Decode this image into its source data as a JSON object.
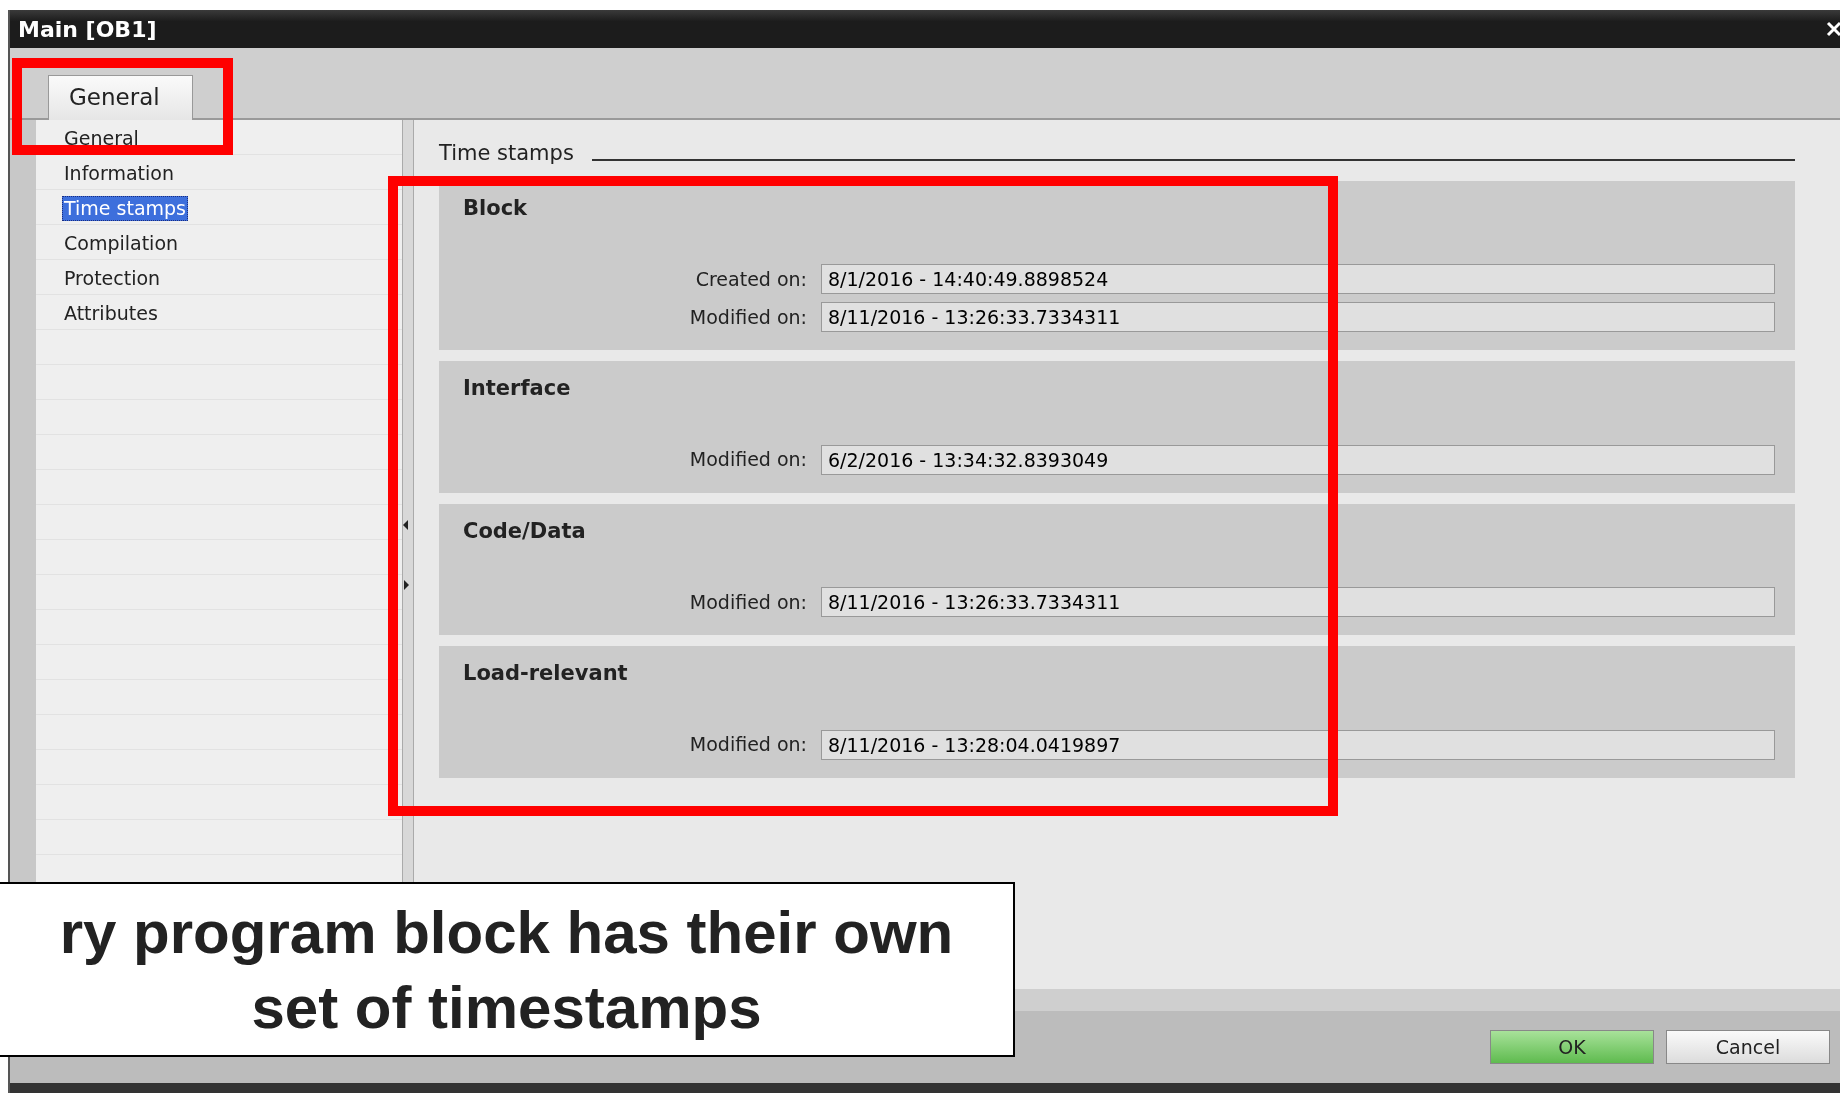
{
  "window": {
    "title": "Main [OB1]"
  },
  "tabs": [
    {
      "label": "General",
      "selected": true
    }
  ],
  "sidebar": {
    "items": [
      {
        "label": "General",
        "selected": false
      },
      {
        "label": "Information",
        "selected": false
      },
      {
        "label": "Time stamps",
        "selected": true
      },
      {
        "label": "Compilation",
        "selected": false
      },
      {
        "label": "Protection",
        "selected": false
      },
      {
        "label": "Attributes",
        "selected": false
      }
    ]
  },
  "section": {
    "title": "Time stamps",
    "groups": [
      {
        "title": "Block",
        "fields": [
          {
            "label": "Created on:",
            "value": "8/1/2016 - 14:40:49.8898524"
          },
          {
            "label": "Modified on:",
            "value": "8/11/2016 - 13:26:33.7334311"
          }
        ]
      },
      {
        "title": "Interface",
        "fields": [
          {
            "label": "Modified on:",
            "value": "6/2/2016 - 13:34:32.8393049"
          }
        ]
      },
      {
        "title": "Code/Data",
        "fields": [
          {
            "label": "Modified on:",
            "value": "8/11/2016 - 13:26:33.7334311"
          }
        ]
      },
      {
        "title": "Load-relevant",
        "fields": [
          {
            "label": "Modified on:",
            "value": "8/11/2016 - 13:28:04.0419897"
          }
        ]
      }
    ]
  },
  "buttons": [
    {
      "label": "OK",
      "kind": "primary"
    },
    {
      "label": "Cancel",
      "kind": "secondary"
    }
  ],
  "callout": {
    "lines": [
      "ry program block has their own",
      "set of timestamps"
    ]
  }
}
